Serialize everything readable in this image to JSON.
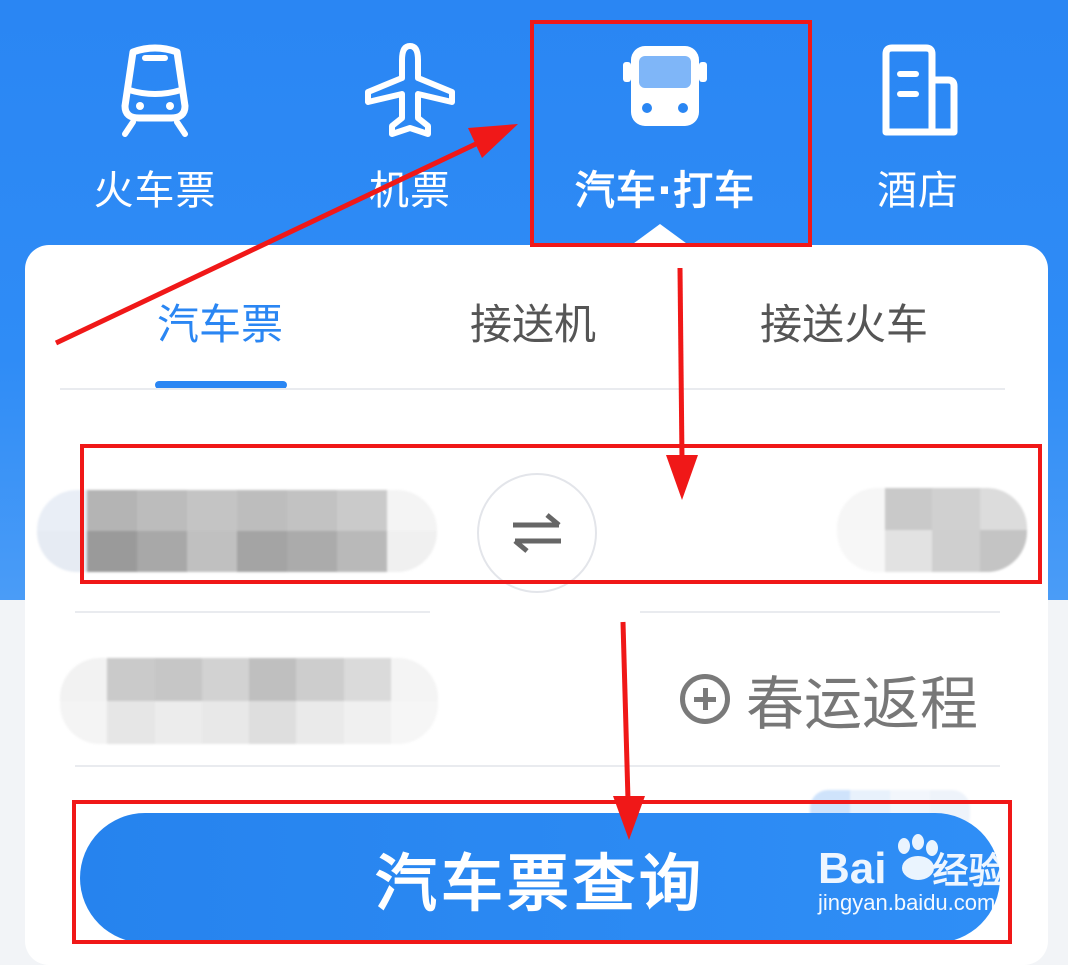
{
  "categories": [
    {
      "label": "火车票",
      "icon": "train-icon"
    },
    {
      "label": "机票",
      "icon": "plane-icon"
    },
    {
      "label": "汽车·打车",
      "icon": "bus-icon",
      "active": true
    },
    {
      "label": "酒店",
      "icon": "hotel-icon"
    }
  ],
  "tabs": [
    {
      "label": "汽车票",
      "active": true
    },
    {
      "label": "接送机"
    },
    {
      "label": "接送火车"
    }
  ],
  "form": {
    "swap_icon": "swap-arrows-icon",
    "return_trip_label": "春运返程",
    "search_button_label": "汽车票查询"
  },
  "watermark": {
    "brand_a": "Bai",
    "brand_b": "经验",
    "url": "jingyan.baidu.com"
  },
  "colors": {
    "accent": "#2a86f3",
    "annotation_red": "#f01818"
  }
}
